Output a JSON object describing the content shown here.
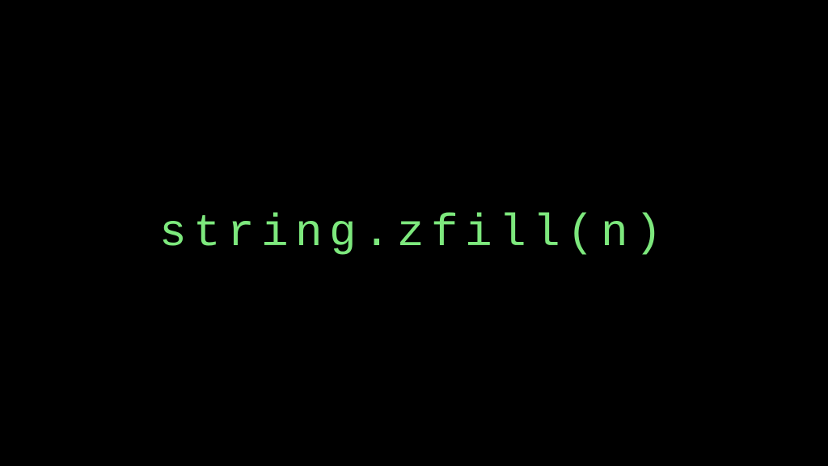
{
  "code": {
    "text": "string.zfill(n)"
  },
  "colors": {
    "background": "#000000",
    "text": "#7de87d"
  }
}
